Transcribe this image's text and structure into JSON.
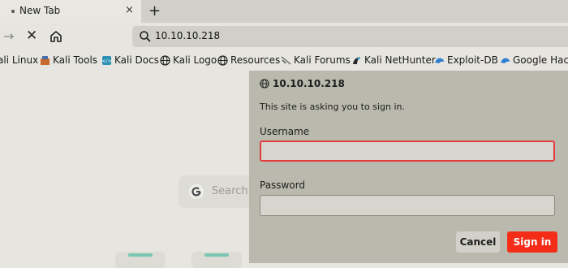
{
  "tabs": [
    {
      "title": "New Tab",
      "close": "×"
    }
  ],
  "new_tab_label": "+",
  "nav": {
    "forward": "→",
    "stop": "✕"
  },
  "url": {
    "value": "10.10.10.218"
  },
  "bookmarks": [
    {
      "label": "ali Linux",
      "icon": "kali-icon"
    },
    {
      "label": "Kali Tools",
      "icon": "kali-tools-icon"
    },
    {
      "label": "Kali Docs",
      "icon": "docs-icon"
    },
    {
      "label": "Kali Logo",
      "icon": "globe-icon"
    },
    {
      "label": "Resources",
      "icon": "globe-icon"
    },
    {
      "label": "Kali Forums",
      "icon": "forum-icon"
    },
    {
      "label": "Kali NetHunter",
      "icon": "nethunter-icon"
    },
    {
      "label": "Exploit-DB",
      "icon": "exploit-db-icon"
    },
    {
      "label": "Google Hacki",
      "icon": "google-hacking-icon"
    }
  ],
  "page": {
    "search_placeholder": "Search"
  },
  "dialog": {
    "host": "10.10.10.218",
    "message": "This site is asking you to sign in.",
    "username_label": "Username",
    "username_value": "",
    "password_label": "Password",
    "password_value": "",
    "cancel": "Cancel",
    "signin": "Sign in"
  },
  "colors": {
    "accent": "#f32d18",
    "focus_border": "#e43c3c",
    "dialog_bg": "#b9b9ad"
  }
}
